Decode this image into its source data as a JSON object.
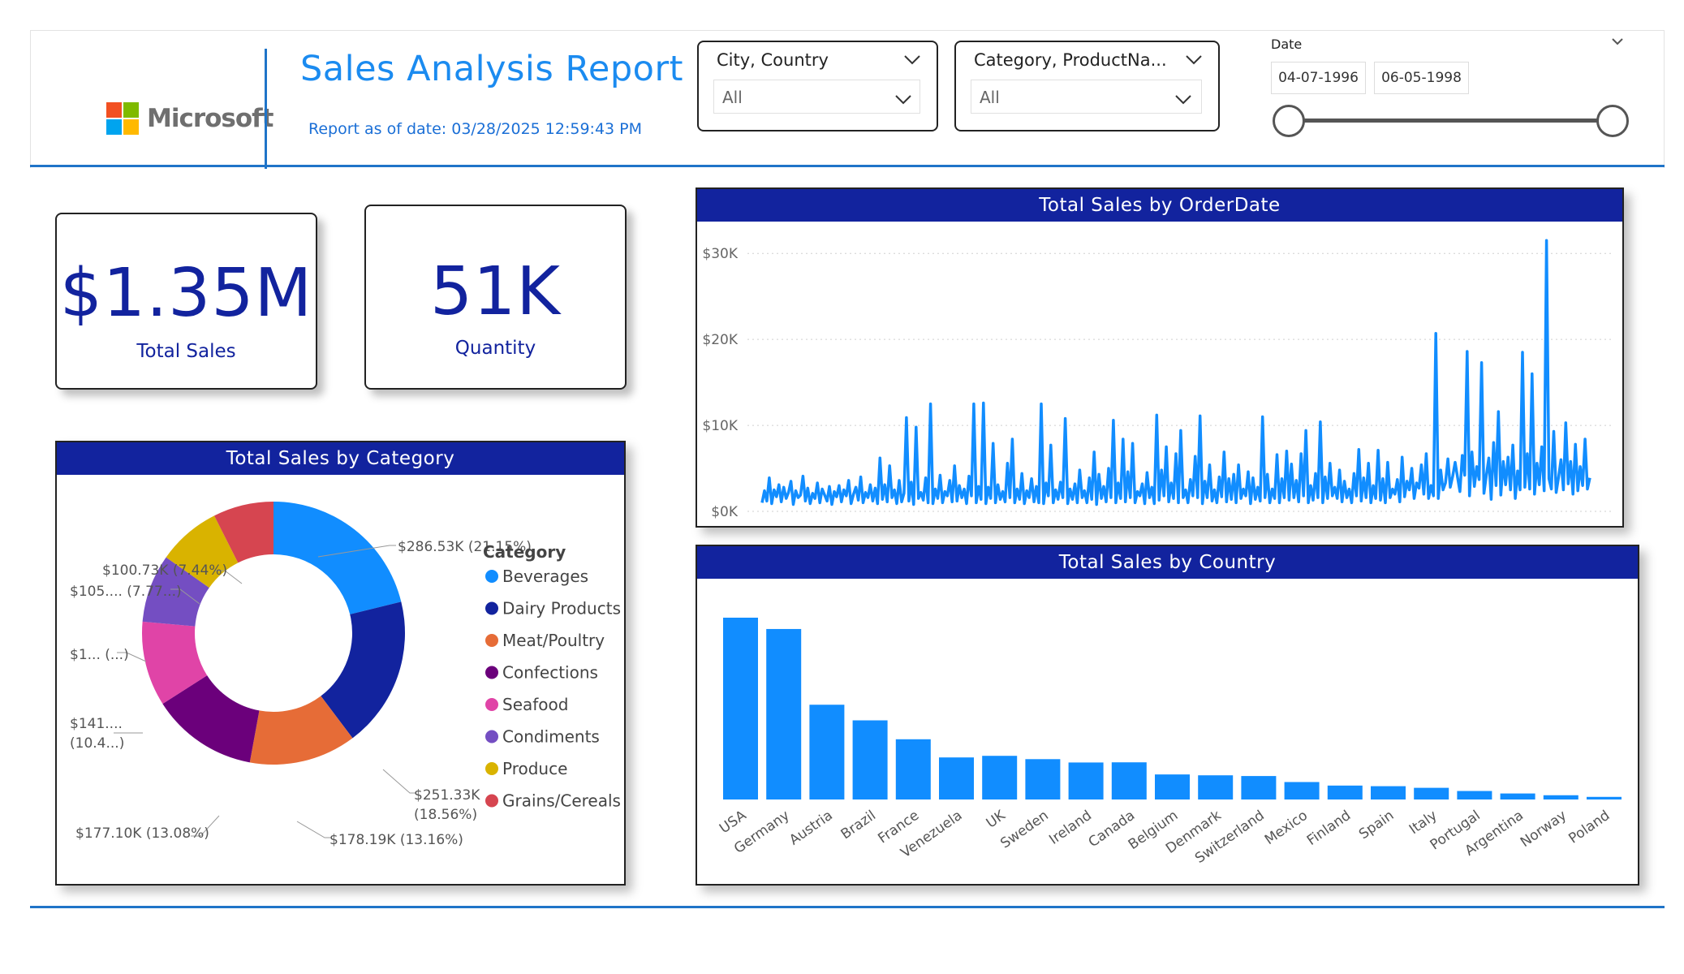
{
  "header": {
    "logo_text": "Microsoft",
    "title": "Sales Analysis Report",
    "report_date": "Report as of date: 03/28/2025 12:59:43 PM"
  },
  "slicers": {
    "city_country": {
      "title": "City, Country",
      "value": "All",
      "chevron": "chevron-down-icon"
    },
    "category_product": {
      "title": "Category, ProductNa...",
      "value": "All",
      "chevron": "chevron-down-icon"
    },
    "date": {
      "label": "Date",
      "start": "04-07-1996",
      "end": "06-05-1998",
      "start_position": 0,
      "end_position": 1
    }
  },
  "kpis": {
    "total_sales": {
      "value": "$1.35M",
      "label": "Total Sales"
    },
    "quantity": {
      "value": "51K",
      "label": "Quantity"
    }
  },
  "colors": {
    "accent": "#1f74c8",
    "title_bar": "#12239e",
    "bar": "#118dff",
    "line": "#118dff",
    "kpi_text": "#12239e"
  },
  "chart_data": [
    {
      "id": "category",
      "type": "pie",
      "title": "Total Sales by Category",
      "legend_title": "Category",
      "legend_position": "right",
      "donut": true,
      "slices": [
        {
          "name": "Beverages",
          "value": 286.53,
          "color": "#118dff",
          "label": "$286.53K (21.15%)"
        },
        {
          "name": "Dairy Products",
          "value": 251.33,
          "color": "#12239e",
          "label": "$251.33K (18.56%)"
        },
        {
          "name": "Meat/Poultry",
          "value": 178.19,
          "color": "#e66c37",
          "label": "$178.19K (13.16%)"
        },
        {
          "name": "Confections",
          "value": 177.1,
          "color": "#6b007b",
          "label": "$177.10K (13.08%)"
        },
        {
          "name": "Seafood",
          "value": 141.0,
          "color": "#e044a7",
          "label": "$141.... (10.4...)"
        },
        {
          "name": "Condiments",
          "value": 113.7,
          "color": "#744ec2",
          "label": "$1... (...)"
        },
        {
          "name": "Produce",
          "value": 105.3,
          "color": "#d9b300",
          "label": "$105.... (7.77...)"
        },
        {
          "name": "Grains/Cereals",
          "value": 100.73,
          "color": "#d64550",
          "label": "$100.73K (7.44%)"
        }
      ]
    },
    {
      "id": "orderdate",
      "type": "line",
      "title": "Total Sales by OrderDate",
      "grid": true,
      "ylim": [
        0,
        32000
      ],
      "yticks": [
        {
          "value": 0,
          "label": "$0K"
        },
        {
          "value": 10000,
          "label": "$10K"
        },
        {
          "value": 20000,
          "label": "$20K"
        },
        {
          "value": 30000,
          "label": "$30K"
        }
      ],
      "series": [
        {
          "values": [
            1000,
            2400,
            1200,
            3900,
            900,
            2500,
            1700,
            3100,
            1100,
            2800,
            1500,
            2200,
            3500,
            800,
            2400,
            1600,
            1900,
            4100,
            1200,
            2700,
            900,
            2100,
            1500,
            3300,
            1000,
            2600,
            1900,
            1200,
            2900,
            800,
            2300,
            1700,
            3000,
            1100,
            2500,
            1800,
            3600,
            900,
            2000,
            2800,
            1300,
            4000,
            1000,
            2200,
            1600,
            3100,
            1200,
            2700,
            900,
            6200,
            1400,
            3100,
            1100,
            5300,
            1600,
            2500,
            900,
            3600,
            1100,
            2100,
            10900,
            1200,
            3400,
            800,
            9800,
            1500,
            2200,
            1300,
            3900,
            1000,
            12500,
            900,
            2600,
            1500,
            4200,
            1000,
            2300,
            1800,
            3600,
            1100,
            5300,
            1200,
            3000,
            1600,
            2600,
            900,
            4100,
            1800,
            12500,
            1000,
            2900,
            1400,
            12600,
            900,
            2800,
            1500,
            7900,
            1000,
            3100,
            1400,
            2300,
            1100,
            5600,
            1600,
            8400,
            1000,
            2600,
            1400,
            4400,
            900,
            2400,
            1600,
            3800,
            1100,
            2900,
            1000,
            12500,
            900,
            3300,
            1800,
            7700,
            1000,
            2500,
            1400,
            3400,
            1600,
            10800,
            900,
            2600,
            1400,
            3200,
            1000,
            4800,
            1600,
            2400,
            1000,
            3900,
            1400,
            6900,
            800,
            4300,
            1500,
            2900,
            1100,
            5000,
            1600,
            10600,
            1000,
            3300,
            1500,
            8400,
            1100,
            4600,
            1600,
            7900,
            1000,
            2300,
            1800,
            3200,
            900,
            4500,
            1600,
            2800,
            900,
            11200,
            1300,
            4800,
            1800,
            7500,
            1100,
            3300,
            1500,
            6700,
            1000,
            9400,
            1600,
            2500,
            1000,
            3700,
            1800,
            6400,
            1600,
            11100,
            900,
            3500,
            1600,
            5400,
            1200,
            2500,
            1000,
            4000,
            1700,
            6900,
            1100,
            3800,
            1400,
            4300,
            1000,
            5400,
            1500,
            2600,
            1800,
            4600,
            900,
            3900,
            1400,
            2800,
            1200,
            11000,
            1600,
            4300,
            1000,
            2600,
            1500,
            6600,
            1000,
            3800,
            1600,
            7000,
            1300,
            5500,
            1600,
            3600,
            1100,
            6700,
            1800,
            9400,
            1000,
            3000,
            1300,
            4400,
            1600,
            10400,
            1000,
            4000,
            1500,
            5600,
            1800,
            2800,
            1500,
            4800,
            1100,
            3500,
            1600,
            2600,
            1000,
            4400,
            1800,
            7200,
            1200,
            3900,
            1600,
            5600,
            1000,
            3000,
            1500,
            7100,
            1300,
            3800,
            1000,
            5700,
            1600,
            2600,
            2000,
            3700,
            1100,
            6300,
            1700,
            3500,
            2500,
            5000,
            1500,
            3300,
            2700,
            5400,
            2000,
            6700,
            1500,
            3000,
            1800,
            20700,
            1500,
            4800,
            2500,
            3300,
            6100,
            2800,
            4100,
            5700,
            4000,
            2300,
            6500,
            4200,
            18600,
            1800,
            6900,
            2900,
            5200,
            3700,
            17300,
            2100,
            4200,
            6200,
            1400,
            8000,
            3000,
            11600,
            1900,
            5800,
            3100,
            6300,
            2500,
            7700,
            1500,
            4700,
            2500,
            18500,
            2800,
            6700,
            2600,
            16000,
            2000,
            5600,
            3100,
            7500,
            2400,
            31500,
            3800,
            2600,
            9300,
            2200,
            4000,
            6000,
            2500,
            10300,
            3200,
            5800,
            2000,
            7800,
            2400,
            5200,
            3000,
            8400,
            2600,
            3900
          ]
        }
      ]
    },
    {
      "id": "country",
      "type": "bar",
      "title": "Total Sales by Country",
      "categories": [
        "USA",
        "Germany",
        "Austria",
        "Brazil",
        "France",
        "Venezuela",
        "UK",
        "Sweden",
        "Ireland",
        "Canada",
        "Belgium",
        "Denmark",
        "Switzerland",
        "Mexico",
        "Finland",
        "Spain",
        "Italy",
        "Portugal",
        "Argentina",
        "Norway",
        "Poland"
      ],
      "values": [
        245580,
        230290,
        128000,
        106900,
        81350,
        56810,
        58970,
        54500,
        49980,
        50200,
        33830,
        32660,
        31690,
        23580,
        18810,
        17980,
        15770,
        11470,
        8120,
        5740,
        3530
      ]
    }
  ]
}
